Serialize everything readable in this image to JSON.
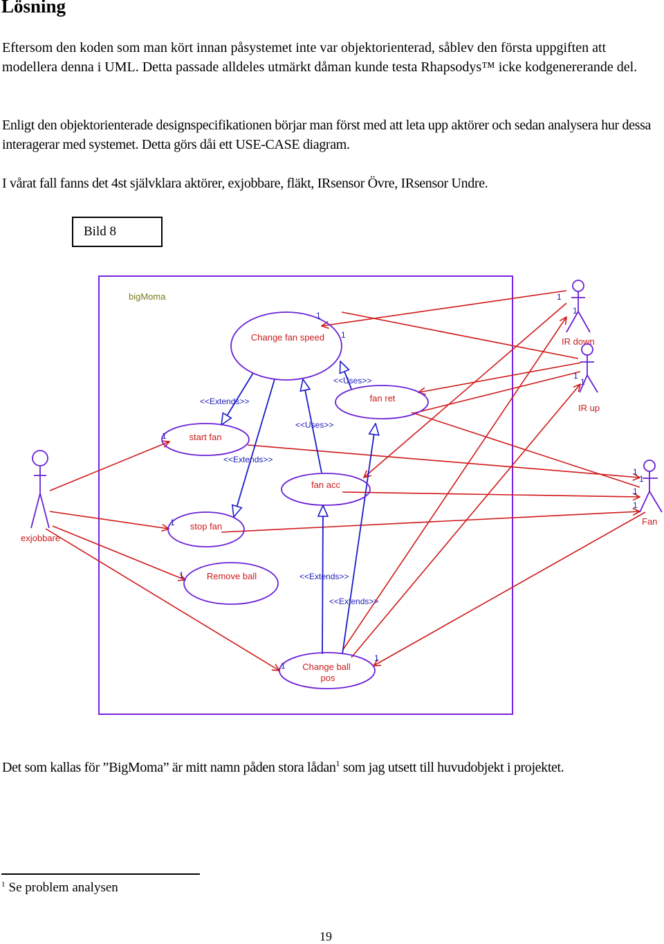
{
  "heading": "Lösning",
  "paragraphs": {
    "p1": "Eftersom den koden som man kört innan påsystemet inte var objektorienterad, såblev den första uppgiften att modellera denna i UML. Detta passade alldeles utmärkt dåman kunde testa Rhapsodys™ icke kodgenererande del.",
    "p2": "Enligt den objektorienterade designspecifikationen börjar man först med att leta upp aktörer och sedan analysera hur dessa interagerar med systemet. Detta görs dåi ett USE-CASE diagram.",
    "p3": "I vårat fall fanns det 4st självklara aktörer, exjobbare, fläkt, IRsensor Övre, IRsensor Undre.",
    "p4_before": "Det som kallas för ”BigMoma” är mitt namn påden stora lådan",
    "p4_sup": "1",
    "p4_after": " som jag utsett till huvudobjekt i projektet."
  },
  "figure_caption": "Bild 8",
  "diagram": {
    "system_name": "bigMoma",
    "colors": {
      "boundary": "#7b22e0",
      "usecase_border": "#6a1fd6",
      "usecase_text": "#cc1a1a",
      "association": "#d01818",
      "generalization": "#1a1ac8",
      "stereotype_text": "#1a1ab8",
      "multiplicity": "#1a1ab8",
      "system_name": "#7a7a20",
      "actor": "#6a1fd6",
      "actor_label": "#cc1a1a"
    },
    "actors": [
      {
        "id": "ir_down",
        "label": "IR down"
      },
      {
        "id": "ir_up",
        "label": "IR up"
      },
      {
        "id": "exjobbare",
        "label": "exjobbare"
      },
      {
        "id": "fan",
        "label": "Fan"
      }
    ],
    "use_cases": [
      {
        "id": "change_fan_speed",
        "label": "Change fan speed"
      },
      {
        "id": "fan_ret",
        "label": "fan ret"
      },
      {
        "id": "start_fan",
        "label": "start fan"
      },
      {
        "id": "fan_acc",
        "label": "fan acc"
      },
      {
        "id": "stop_fan",
        "label": "stop fan"
      },
      {
        "id": "remove_ball",
        "label": "Remove ball"
      },
      {
        "id": "change_ball_pos_1",
        "label": "Change ball"
      },
      {
        "id": "change_ball_pos_2",
        "label": "pos"
      }
    ],
    "stereotypes": {
      "extends_1": "<<Extends>>",
      "extends_2": "<<Extends>>",
      "extends_3": "<<Extends>>",
      "extends_4": "<<Extends>>",
      "uses_1": "<<Uses>>",
      "uses_2": "<<Uses>>"
    },
    "multiplicity": "1"
  },
  "footnote": {
    "marker": "1",
    "text": "Se problem analysen"
  },
  "page_number": "19"
}
